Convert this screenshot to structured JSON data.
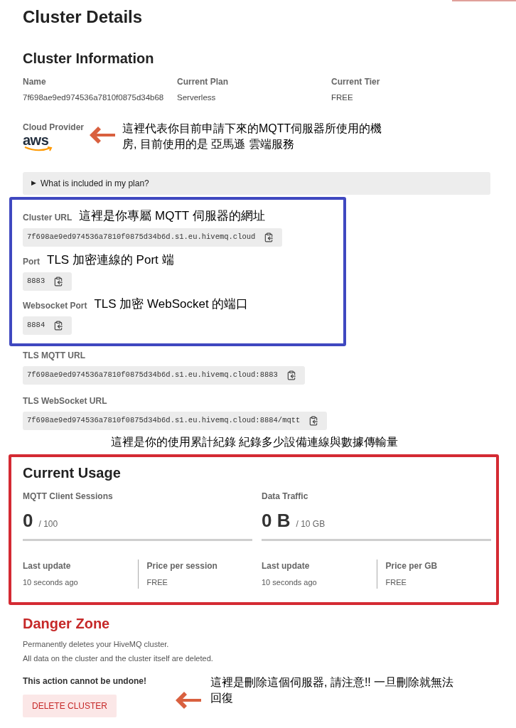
{
  "page_title": "Cluster Details",
  "cluster_information": {
    "title": "Cluster Information",
    "fields": [
      {
        "label": "Name",
        "value": "7f698ae9ed974536a7810f0875d34b68"
      },
      {
        "label": "Current Plan",
        "value": "Serverless"
      },
      {
        "label": "Current Tier",
        "value": "FREE"
      }
    ],
    "cloud_provider": {
      "label": "Cloud Provider",
      "logo_text": "aws",
      "note": "這裡代表你目前申請下來的MQTT伺服器所使用的機房, 目前使用的是 亞馬遜 雲端服務"
    }
  },
  "plan_disclosure": {
    "marker": "▶",
    "label": "What is included in my plan?",
    "expanded": false
  },
  "connection": {
    "highlighted": [
      {
        "label": "Cluster URL",
        "value": "7f698ae9ed974536a7810f0875d34b6d.s1.eu.hivemq.cloud",
        "note": "這裡是你專屬 MQTT 伺服器的網址"
      },
      {
        "label": "Port",
        "value": "8883",
        "note": "TLS 加密連線的 Port 端"
      },
      {
        "label": "Websocket Port",
        "value": "8884",
        "note": "TLS 加密  WebSocket 的端口"
      }
    ],
    "others": [
      {
        "label": "TLS MQTT URL",
        "value": "7f698ae9ed974536a7810f0875d34b6d.s1.eu.hivemq.cloud:8883"
      },
      {
        "label": "TLS WebSocket URL",
        "value": "7f698ae9ed974536a7810f0875d34b6d.s1.eu.hivemq.cloud:8884/mqtt"
      }
    ]
  },
  "usage": {
    "note": "這裡是你的使用累計紀錄 紀錄多少設備連線與數據傳輸量",
    "title": "Current Usage",
    "metrics": [
      {
        "label": "MQTT Client Sessions",
        "value": "0",
        "limit": "/ 100",
        "level": 0,
        "stats": [
          {
            "label": "Last update",
            "value": "10 seconds ago"
          },
          {
            "label": "Price per session",
            "value": "FREE"
          }
        ]
      },
      {
        "label": "Data Traffic",
        "value": "0 B",
        "limit": "/ 10 GB",
        "level": 0,
        "stats": [
          {
            "label": "Last update",
            "value": "10 seconds ago"
          },
          {
            "label": "Price per GB",
            "value": "FREE"
          }
        ]
      }
    ]
  },
  "danger_zone": {
    "title": "Danger Zone",
    "description": [
      "Permanently deletes your HiveMQ cluster.",
      "All data on the cluster and the cluster itself are deleted."
    ],
    "warning": "This action cannot be undone!",
    "button": "DELETE CLUSTER",
    "note": "這裡是刪除這個伺服器, 請注意!! 一旦刪除就無法回復"
  }
}
